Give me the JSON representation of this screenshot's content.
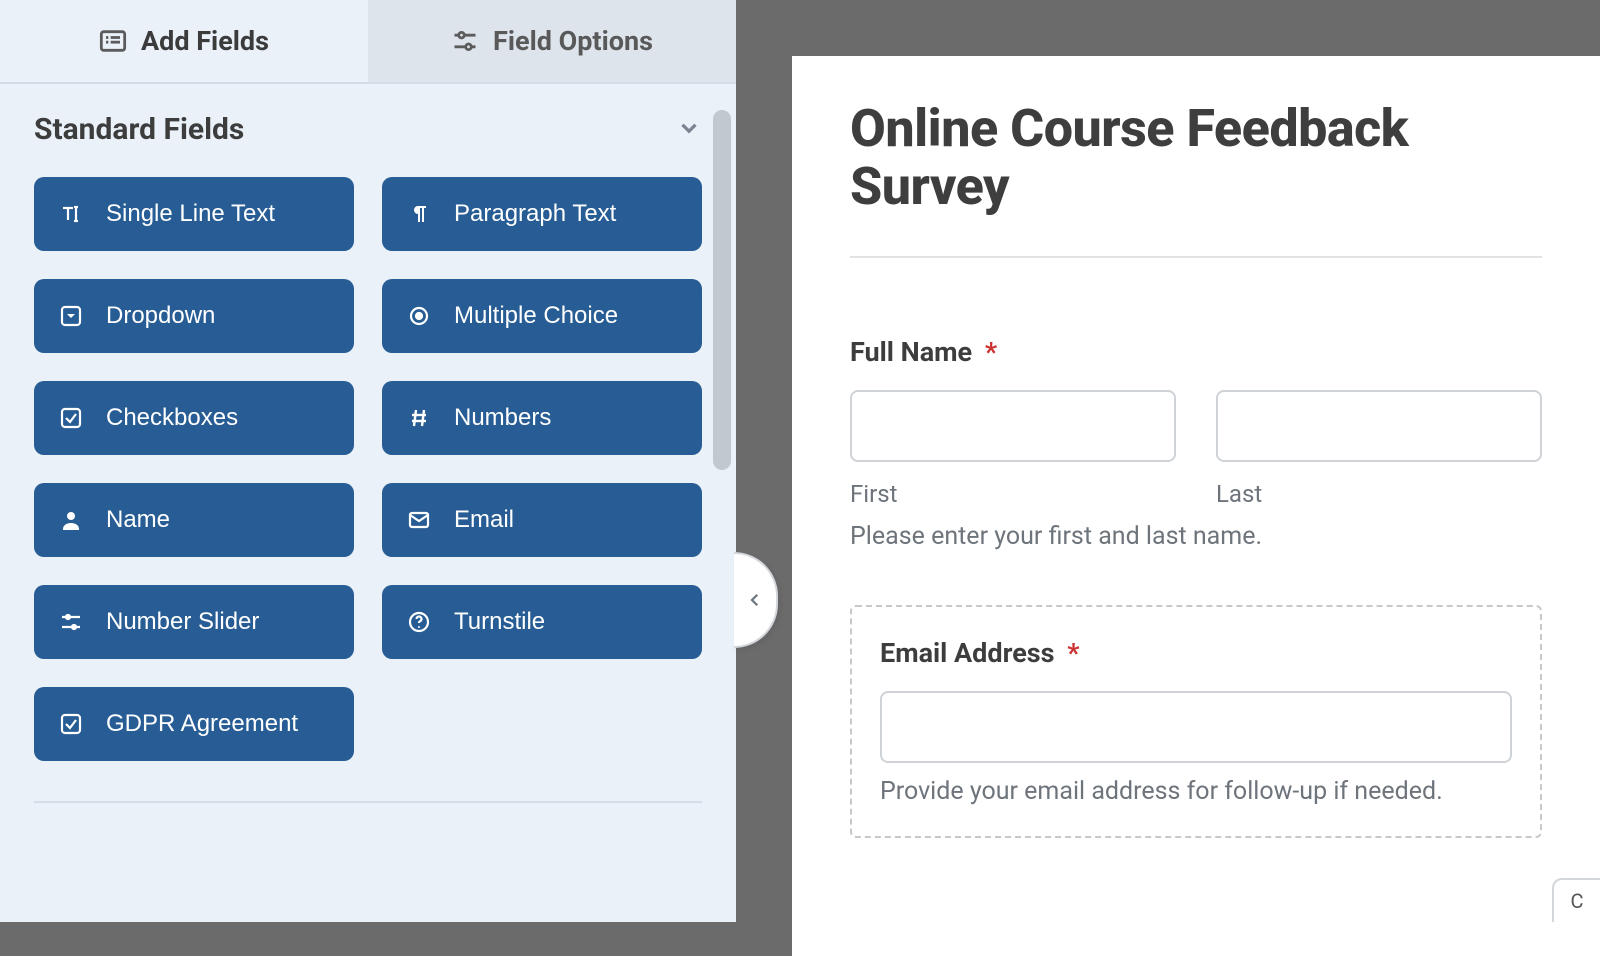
{
  "tabs": {
    "add_fields": "Add Fields",
    "field_options": "Field Options"
  },
  "section": {
    "standard_fields": "Standard Fields"
  },
  "fields": {
    "single_line_text": "Single Line Text",
    "paragraph_text": "Paragraph Text",
    "dropdown": "Dropdown",
    "multiple_choice": "Multiple Choice",
    "checkboxes": "Checkboxes",
    "numbers": "Numbers",
    "name": "Name",
    "email": "Email",
    "number_slider": "Number Slider",
    "turnstile": "Turnstile",
    "gdpr_agreement": "GDPR Agreement"
  },
  "form": {
    "title": "Online Course Feedback Survey",
    "full_name": {
      "label": "Full Name",
      "required": "*",
      "first_sub": "First",
      "last_sub": "Last",
      "desc": "Please enter your first and last name."
    },
    "email": {
      "label": "Email Address",
      "required": "*",
      "desc": "Provide your email address for follow-up if needed."
    }
  },
  "corner": "C"
}
